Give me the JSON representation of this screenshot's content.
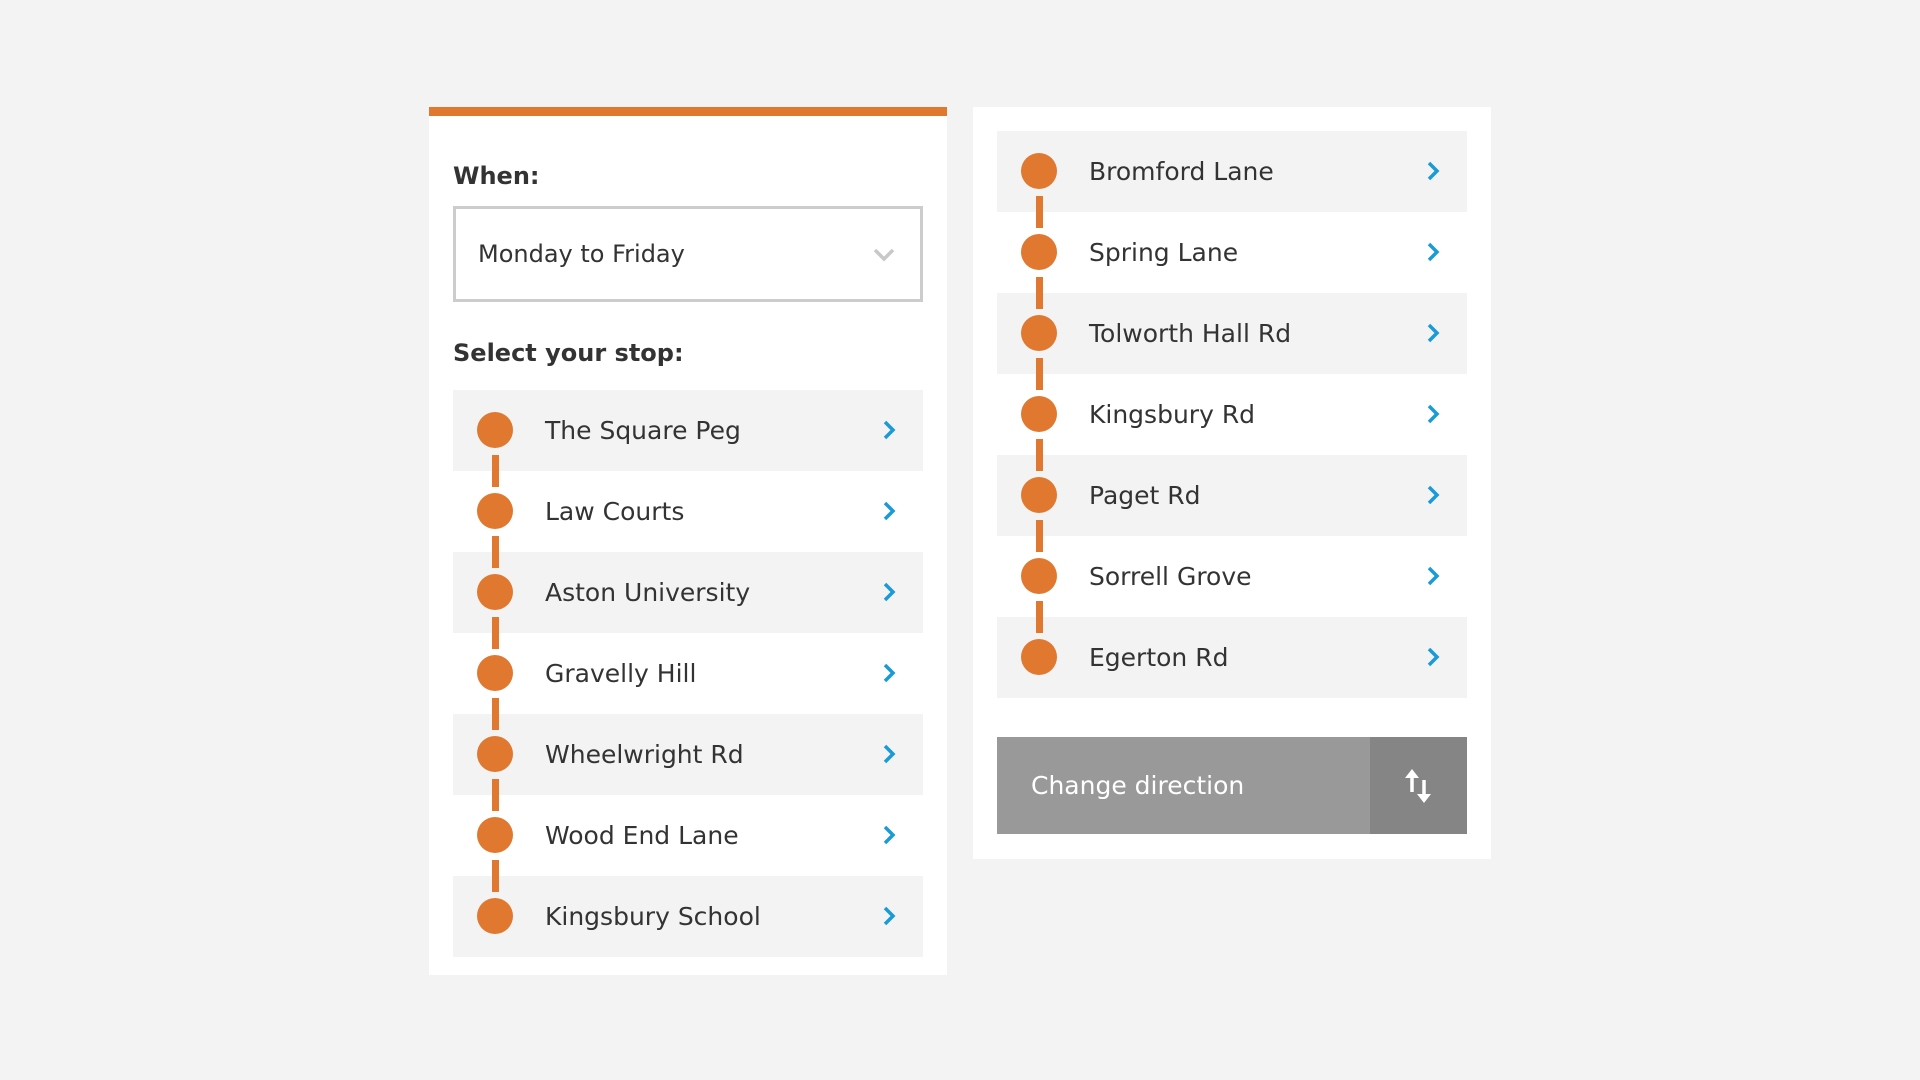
{
  "colors": {
    "accent": "#e07830",
    "link": "#1a9ad6",
    "button": "#999999",
    "button_icon_bg": "#858585"
  },
  "left_panel": {
    "when_label": "When:",
    "when_select": {
      "value": "Monday to Friday",
      "icon": "chevron-down-icon"
    },
    "stop_label": "Select your stop:",
    "stops": [
      {
        "name": "The Square Peg"
      },
      {
        "name": "Law Courts"
      },
      {
        "name": "Aston University"
      },
      {
        "name": "Gravelly Hill"
      },
      {
        "name": "Wheelwright Rd"
      },
      {
        "name": "Wood End Lane"
      },
      {
        "name": "Kingsbury School"
      }
    ]
  },
  "right_panel": {
    "stops": [
      {
        "name": "Bromford Lane"
      },
      {
        "name": "Spring Lane"
      },
      {
        "name": "Tolworth Hall Rd"
      },
      {
        "name": "Kingsbury Rd"
      },
      {
        "name": "Paget Rd"
      },
      {
        "name": "Sorrell Grove"
      },
      {
        "name": "Egerton Rd"
      }
    ],
    "change_direction": {
      "label": "Change direction",
      "icon": "swap-vertical-icon"
    }
  }
}
